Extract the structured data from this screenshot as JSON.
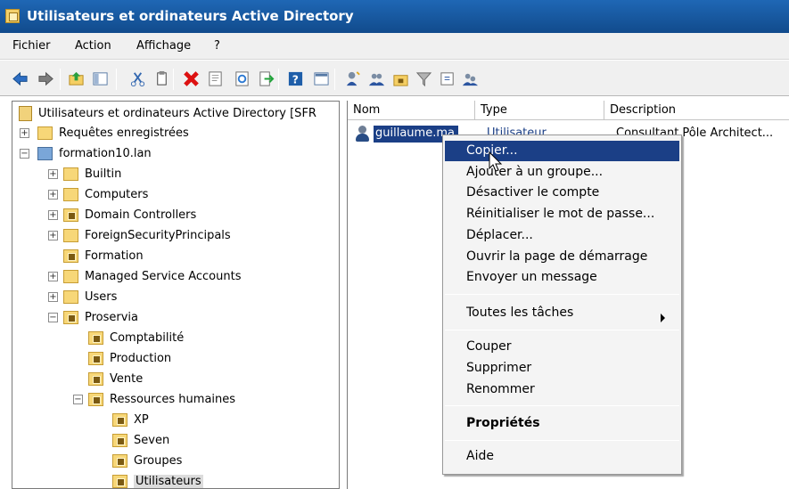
{
  "window": {
    "title": "Utilisateurs et ordinateurs Active Directory"
  },
  "menubar": {
    "items": [
      "Fichier",
      "Action",
      "Affichage",
      "?"
    ]
  },
  "toolbar": {
    "icons": [
      "back-arrow-icon",
      "forward-arrow-icon",
      "up-folder-icon",
      "show-hide-console-tree-icon",
      "cut-icon",
      "copy-icon",
      "delete-icon",
      "properties-icon",
      "refresh-icon",
      "export-list-icon",
      "help-icon",
      "new-window-icon",
      "add-user-icon",
      "add-group-icon",
      "add-ou-icon",
      "filter-icon",
      "find-icon",
      "domain-controllers-icon"
    ]
  },
  "tree": {
    "root": "Utilisateurs et ordinateurs Active Directory [SFR",
    "items": [
      "Requêtes enregistrées",
      "formation10.lan",
      "Builtin",
      "Computers",
      "Domain Controllers",
      "ForeignSecurityPrincipals",
      "Formation",
      "Managed Service Accounts",
      "Users",
      "Proservia",
      "Comptabilité",
      "Production",
      "Vente",
      "Ressources humaines",
      "XP",
      "Seven",
      "Groupes",
      "Utilisateurs"
    ]
  },
  "list": {
    "headers": [
      "Nom",
      "Type",
      "Description"
    ],
    "rows": [
      {
        "name": "guillaume.ma...",
        "type": "Utilisateur",
        "description": "Consultant Pôle Architect..."
      }
    ]
  },
  "context_menu": {
    "items": [
      "Copier...",
      "Ajouter à un groupe...",
      "Désactiver le compte",
      "Réinitialiser le mot de passe...",
      "Déplacer...",
      "Ouvrir la page de démarrage",
      "Envoyer un message",
      "Toutes les tâches",
      "Couper",
      "Supprimer",
      "Renommer",
      "Propriétés",
      "Aide"
    ]
  }
}
